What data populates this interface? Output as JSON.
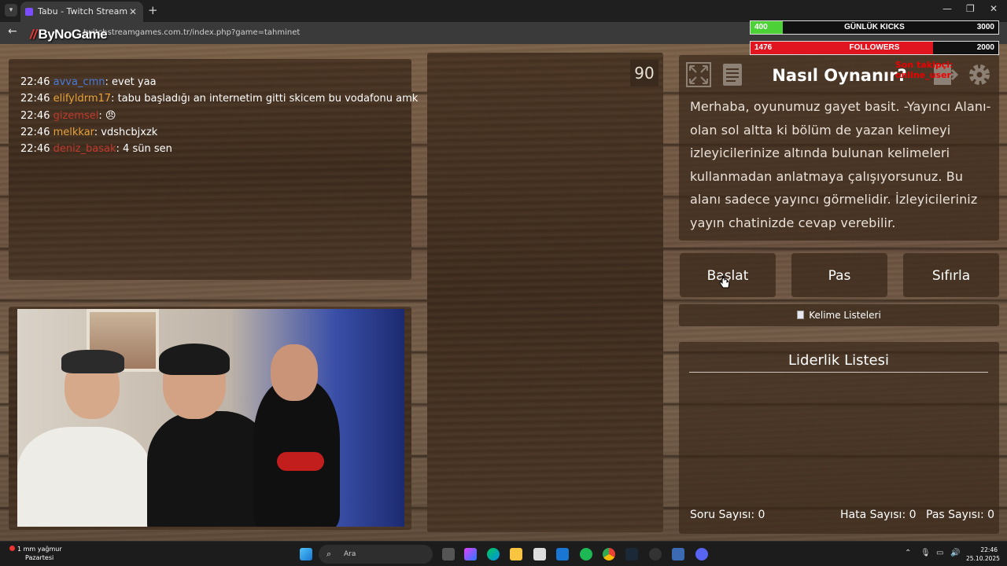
{
  "browser": {
    "tab_title": "Tabu - Twitch Stream Games",
    "url": "twitchstreamgames.com.tr/index.php?game=tahminet",
    "new_tab_symbol": "+",
    "close_symbol": "✕"
  },
  "logo": {
    "text": "ByNoGame",
    "mark": "//"
  },
  "overlay": {
    "kicks": {
      "current": "400",
      "label": "GÜNLÜK KICKS",
      "goal": "3000",
      "progress": 0.13,
      "color": "#4cd137"
    },
    "followers": {
      "current": "1476",
      "label": "FOLLOWERS",
      "goal": "2000",
      "progress": 0.738,
      "color": "#e0151f"
    },
    "red_note": "Son takipçi: online_user"
  },
  "chat": {
    "messages": [
      {
        "time": "22:46",
        "user": "avva_cmn",
        "user_color": "#4a7bd9",
        "text": ": evet yaa"
      },
      {
        "time": "22:46",
        "user": "elifyldrm17",
        "user_color": "#e8a33a",
        "text": ": tabu başladığı an internetim gitti skicem bu vodafonu amk"
      },
      {
        "time": "22:46",
        "user": "gizemsel",
        "user_color": "#c0392b",
        "text": ": 😠"
      },
      {
        "time": "22:46",
        "user": "melkkar",
        "user_color": "#e8a33a",
        "text": ": vdshcbjxzk"
      },
      {
        "time": "22:46",
        "user": "deniz_basak",
        "user_color": "#c0392b",
        "text": ": 4 sün sen"
      }
    ]
  },
  "timer": "90",
  "how_to": {
    "title": "Nasıl Oynanır?",
    "text": "Merhaba, oyunumuz gayet basit. -Yayıncı Alanı- olan sol altta ki bölüm de yazan kelimeyi izleyicilerinize altında bulunan kelimeleri kullanmadan anlatmaya çalışıyorsunuz. Bu alanı sadece yayıncı görmelidir. İzleyicileriniz yayın chatinizde cevap verebilir."
  },
  "buttons": {
    "start": "Başlat",
    "pass": "Pas",
    "reset": "Sıfırla",
    "word_lists": "Kelime Listeleri"
  },
  "leaderboard": {
    "title": "Liderlik Listesi"
  },
  "stats": {
    "questions_label": "Soru Sayısı:",
    "questions": "0",
    "errors_label": "Hata Sayısı:",
    "errors": "0",
    "passes_label": "Pas Sayısı:",
    "passes": "0"
  },
  "taskbar": {
    "weather_line1": "1 mm yağmur",
    "weather_line2": "Pazartesi",
    "search_placeholder": "Ara",
    "time": "22:46",
    "date": "25.10.2025"
  }
}
